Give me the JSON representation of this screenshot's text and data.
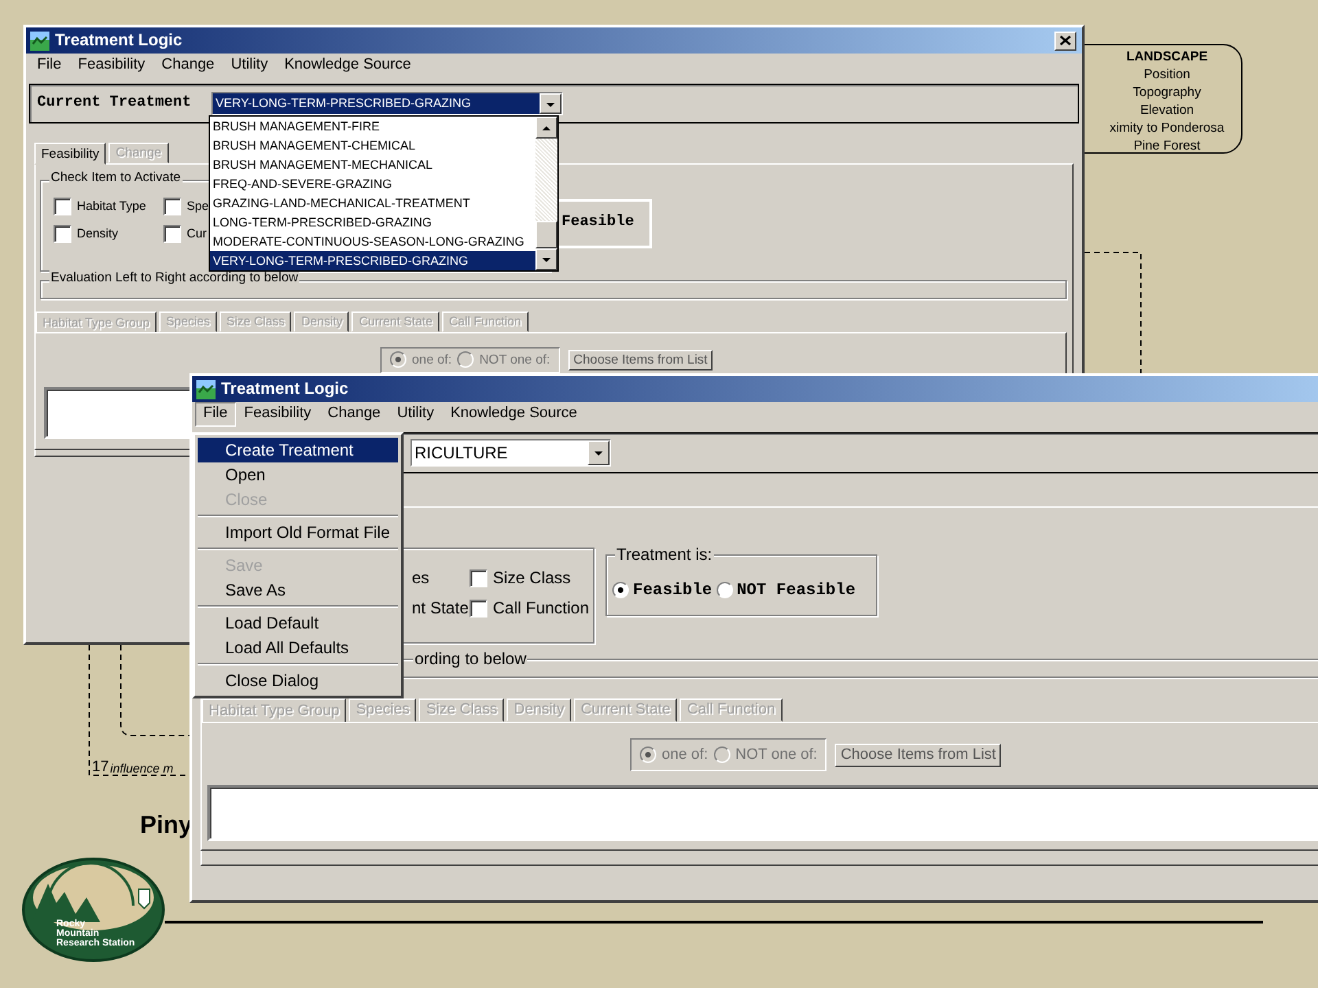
{
  "slide": {
    "landscape": {
      "title": "LANDSCAPE",
      "lines": [
        "Position",
        "Topography",
        "Elevation",
        "ximity to Ponderosa",
        "Pine Forest"
      ]
    },
    "footnote": {
      "number": "17",
      "text": "influence m"
    },
    "heading": "Piny",
    "logo": {
      "lines": [
        "Rocky",
        "Mountain",
        "Research Station"
      ]
    }
  },
  "windows": [
    {
      "title": "Treatment Logic",
      "menu": [
        {
          "label": "File",
          "selected": false
        },
        {
          "label": "Feasibility",
          "selected": false
        },
        {
          "label": "Change",
          "selected": false
        },
        {
          "label": "Utility",
          "selected": false
        },
        {
          "label": "Knowledge Source",
          "selected": false
        }
      ],
      "current_treatment": {
        "label": "Current Treatment",
        "value": "VERY-LONG-TERM-PRESCRIBED-GRAZING",
        "expanded": true
      },
      "dropdown_items": [
        {
          "label": "BRUSH MANAGEMENT-FIRE",
          "selected": false
        },
        {
          "label": "BRUSH MANAGEMENT-CHEMICAL",
          "selected": false
        },
        {
          "label": "BRUSH MANAGEMENT-MECHANICAL",
          "selected": false
        },
        {
          "label": "FREQ-AND-SEVERE-GRAZING",
          "selected": false
        },
        {
          "label": "GRAZING-LAND-MECHANICAL-TREATMENT",
          "selected": false
        },
        {
          "label": "LONG-TERM-PRESCRIBED-GRAZING",
          "selected": false
        },
        {
          "label": "MODERATE-CONTINUOUS-SEASON-LONG-GRAZING",
          "selected": false
        },
        {
          "label": "VERY-LONG-TERM-PRESCRIBED-GRAZING",
          "selected": true
        }
      ],
      "tabs": [
        {
          "label": "Feasibility",
          "selected": true,
          "disabled": false
        },
        {
          "label": "Change",
          "selected": false,
          "disabled": true
        }
      ],
      "check_group": {
        "title": "Check Item to Activate",
        "items": [
          {
            "kind": "checkbox",
            "label": "Habitat Type",
            "checked": false
          },
          {
            "kind": "checkbox",
            "label": "Spe",
            "checked": false
          },
          {
            "kind": "checkbox",
            "label": "Density",
            "checked": false
          },
          {
            "kind": "checkbox",
            "label": "Cur",
            "checked": false
          }
        ]
      },
      "treatment_text": "Feasible",
      "evaluation_title": "Evaluation Left to Right according to below",
      "sub_tabs": [
        {
          "label": "Habitat Type Group",
          "selected": true,
          "disabled": true
        },
        {
          "label": "Species",
          "selected": false,
          "disabled": true
        },
        {
          "label": "Size Class",
          "selected": false,
          "disabled": true
        },
        {
          "label": "Density",
          "selected": false,
          "disabled": true
        },
        {
          "label": "Current State",
          "selected": false,
          "disabled": true
        },
        {
          "label": "Call Function",
          "selected": false,
          "disabled": true
        }
      ],
      "match_options": [
        {
          "label": "one of:",
          "selected": true
        },
        {
          "label": "NOT one of:",
          "selected": false
        }
      ],
      "choose_button": "Choose Items from List"
    },
    {
      "title": "Treatment Logic",
      "menu": [
        {
          "label": "File",
          "selected": true
        },
        {
          "label": "Feasibility",
          "selected": false
        },
        {
          "label": "Change",
          "selected": false
        },
        {
          "label": "Utility",
          "selected": false
        },
        {
          "label": "Knowledge Source",
          "selected": false
        }
      ],
      "file_menu": [
        {
          "kind": "item",
          "label": "Create Treatment",
          "selected": true,
          "disabled": false
        },
        {
          "kind": "item",
          "label": "Open",
          "selected": false,
          "disabled": false
        },
        {
          "kind": "item",
          "label": "Close",
          "selected": false,
          "disabled": true
        },
        {
          "kind": "separator"
        },
        {
          "kind": "item",
          "label": "Import Old Format File",
          "selected": false,
          "disabled": false
        },
        {
          "kind": "separator"
        },
        {
          "kind": "item",
          "label": "Save",
          "selected": false,
          "disabled": true
        },
        {
          "kind": "item",
          "label": "Save As",
          "selected": false,
          "disabled": false
        },
        {
          "kind": "separator"
        },
        {
          "kind": "item",
          "label": "Load Default",
          "selected": false,
          "disabled": false
        },
        {
          "kind": "item",
          "label": "Load All Defaults",
          "selected": false,
          "disabled": false
        },
        {
          "kind": "separator"
        },
        {
          "kind": "item",
          "label": "Close Dialog",
          "selected": false,
          "disabled": false
        }
      ],
      "current_treatment": {
        "value": "RICULTURE",
        "expanded": false
      },
      "check_group": {
        "items": [
          {
            "kind": "text",
            "label": "es"
          },
          {
            "kind": "checkbox",
            "label": "Size Class",
            "checked": false
          },
          {
            "kind": "text",
            "label": "nt State"
          },
          {
            "kind": "checkbox",
            "label": "Call Function",
            "checked": false
          }
        ]
      },
      "treatment": {
        "title": "Treatment is:",
        "options": [
          {
            "label": "Feasible",
            "selected": true
          },
          {
            "label": "NOT Feasible",
            "selected": false
          }
        ]
      },
      "evaluation_title": "ording to below",
      "sub_tabs": [
        {
          "label": "Habitat Type Group",
          "selected": true,
          "disabled": true
        },
        {
          "label": "Species",
          "selected": false,
          "disabled": true
        },
        {
          "label": "Size Class",
          "selected": false,
          "disabled": true
        },
        {
          "label": "Density",
          "selected": false,
          "disabled": true
        },
        {
          "label": "Current State",
          "selected": false,
          "disabled": true
        },
        {
          "label": "Call Function",
          "selected": false,
          "disabled": true
        }
      ],
      "match_options": [
        {
          "label": "one of:",
          "selected": true
        },
        {
          "label": "NOT one of:",
          "selected": false
        }
      ],
      "choose_button": "Choose Items from List"
    }
  ]
}
